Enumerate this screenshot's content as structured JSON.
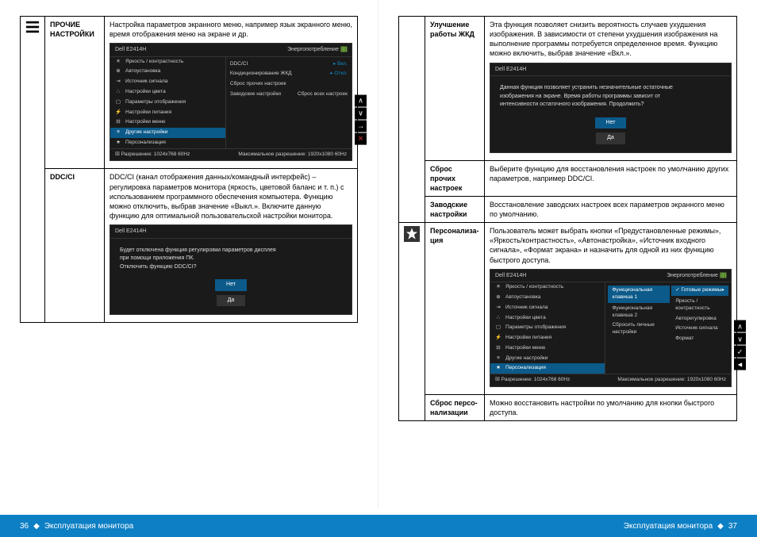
{
  "footer": {
    "left_num": "36",
    "right_num": "37",
    "text": "Эксплуатация монитора",
    "diamond": "◆"
  },
  "page36": {
    "r1": {
      "label": "ПРОЧИЕ НАСТРОЙКИ",
      "text": "Настройка параметров экранного меню, например язык экранного меню, время отображения меню на экране и др."
    },
    "r2": {
      "label": "DDC/CI",
      "text": "DDC/CI (канал отображения данных/командный интерфейс) – регулировка параметров монитора (яркость, цветовой баланс и т. п.) с использованием программного обеспечения компьютера. Функцию можно отключить, выбрав значение «Выкл.». Включите данную функцию для оптимальной пользовательской настройки монитора."
    }
  },
  "page37": {
    "r1": {
      "label": "Улучшение работы ЖКД",
      "text": "Эта функция позволяет снизить вероятность случаев ухудшения изображения. В зависимости от степени ухудшения изображения на выполнение программы потребуется определенное время. Функцию можно включить, выбрав значение «Вкл.»."
    },
    "r2": {
      "label": "Сброс прочих настроек",
      "text": "Выберите функцию для восстановления настроек по умолчанию других параметров, например DDC/CI."
    },
    "r3": {
      "label": "Заводские настройки",
      "text": "Восстановление заводских настроек всех параметров экранного меню по умолчанию."
    },
    "r4": {
      "label": "Персонализа­ция",
      "text": "Пользователь может выбрать кнопки «Предустановленные режимы», «Яркость/контрастность», «Автонастройка», «Источник входного сигнала», «Формат экрана» и назначить для одной из них функцию быстрого доступа."
    },
    "r5": {
      "label": "Сброс персо­нализации",
      "text": "Можно восстановить настройки по умолчанию для кнопки быстрого доступа."
    }
  },
  "osd": {
    "title": "Dell E2414H",
    "energy": "Энергопотребление",
    "menu": {
      "brightness": "Яркость / контрастность",
      "auto": "Автоустановка",
      "source": "Источник сигнала",
      "color": "Настройки цвета",
      "display": "Параметры отображения",
      "power": "Настройки питания",
      "menuset": "Настройки меню",
      "other": "Другие настройки",
      "personal": "Персонализация"
    },
    "foot_res": "Разрешение: 1024x768 60Hz",
    "foot_max": "Максимальное разрешение: 1920x1080 60Hz",
    "ddc": {
      "ddcci": "DDC/CI",
      "on": "Вкл.",
      "cond": "Кондиционирование ЖКД",
      "off": "Откл.",
      "reset": "Сброс прочих настроек",
      "factory": "Заводские настройки",
      "resetall": "Сброс всех настроек"
    },
    "dlg1": {
      "l1": "Будет отключена функция регулировки параметров дисплея",
      "l2": "при помощи приложения ПК.",
      "l3": "Отключить функцию DDC/CI?",
      "no": "Нет",
      "yes": "Да"
    },
    "dlg2": {
      "l1": "Данная функция позволяет устранить незначительные остаточные",
      "l2": "изображения на экране. Время работы программы зависит от",
      "l3": "интенсивности остаточного изображения. Продолжить?",
      "no": "Нет",
      "yes": "Да"
    },
    "pers": {
      "fk1": "Функциональная клавиша 1",
      "fk2": "Функциональная клавиша 2",
      "reset": "Сбросить личные настройки",
      "preset": "Готовые режимы",
      "bc": "Яркость / контрастность",
      "auto": "Авторегулировка",
      "src": "Источник сигнала",
      "fmt": "Формат"
    }
  }
}
